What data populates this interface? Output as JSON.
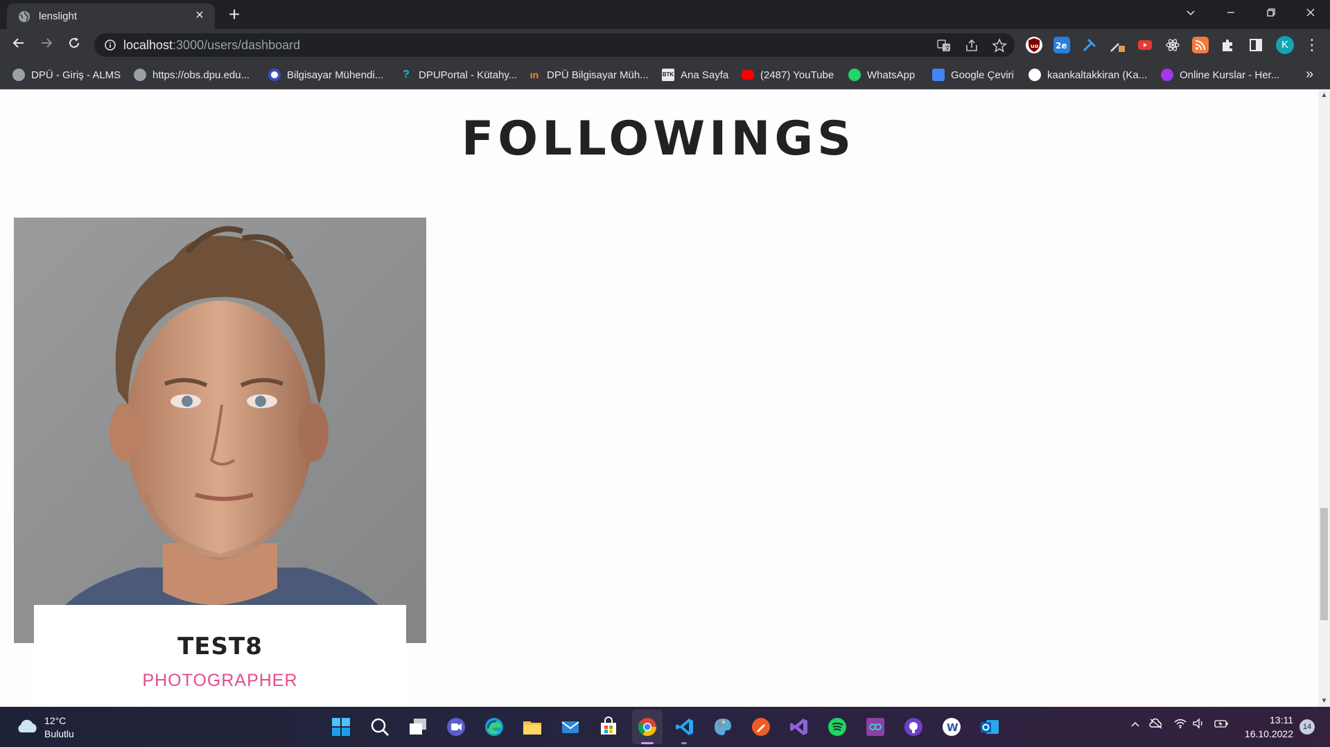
{
  "browser": {
    "tab_title": "lenslight",
    "url_host": "localhost",
    "url_path": ":3000/users/dashboard",
    "profile_initial": "K"
  },
  "bookmarks": [
    {
      "label": "DPÜ - Giriş - ALMS",
      "icon": "globe-icon",
      "color": "#9aa0a6"
    },
    {
      "label": "https://obs.dpu.edu...",
      "icon": "globe-icon",
      "color": "#9aa0a6"
    },
    {
      "label": "Bilgisayar Mühendi...",
      "icon": "dpu-icon",
      "color": "#3a4dbf"
    },
    {
      "label": "DPUPortal - Kütahy...",
      "icon": "portal-icon",
      "color": "#2bb5d4"
    },
    {
      "label": "DPÜ Bilgisayar Müh...",
      "icon": "dpu-orange-icon",
      "color": "#f08a24"
    },
    {
      "label": "Ana Sayfa",
      "icon": "btk-icon",
      "color": "#e8eaed"
    },
    {
      "label": "(2487) YouTube",
      "icon": "youtube-icon",
      "color": "#ff0000"
    },
    {
      "label": "WhatsApp",
      "icon": "whatsapp-icon",
      "color": "#25d366"
    },
    {
      "label": "Google Çeviri",
      "icon": "google-translate-icon",
      "color": "#4285f4"
    },
    {
      "label": "kaankaltakkiran (Ka...",
      "icon": "github-icon",
      "color": "#ffffff"
    },
    {
      "label": "Online Kurslar - Her...",
      "icon": "udemy-icon",
      "color": "#a435f0"
    }
  ],
  "page": {
    "heading": "FOLLOWINGS",
    "card": {
      "name": "TEST8",
      "role": "PHOTOGRAPHER"
    }
  },
  "taskbar": {
    "weather_temp": "12°C",
    "weather_desc": "Bulutlu",
    "time": "13:11",
    "date": "16.10.2022",
    "notification_count": "14"
  },
  "colors": {
    "accent_pink": "#e44d8b",
    "heading": "#222222",
    "chrome_dark": "#202124",
    "chrome_mid": "#35363a"
  }
}
